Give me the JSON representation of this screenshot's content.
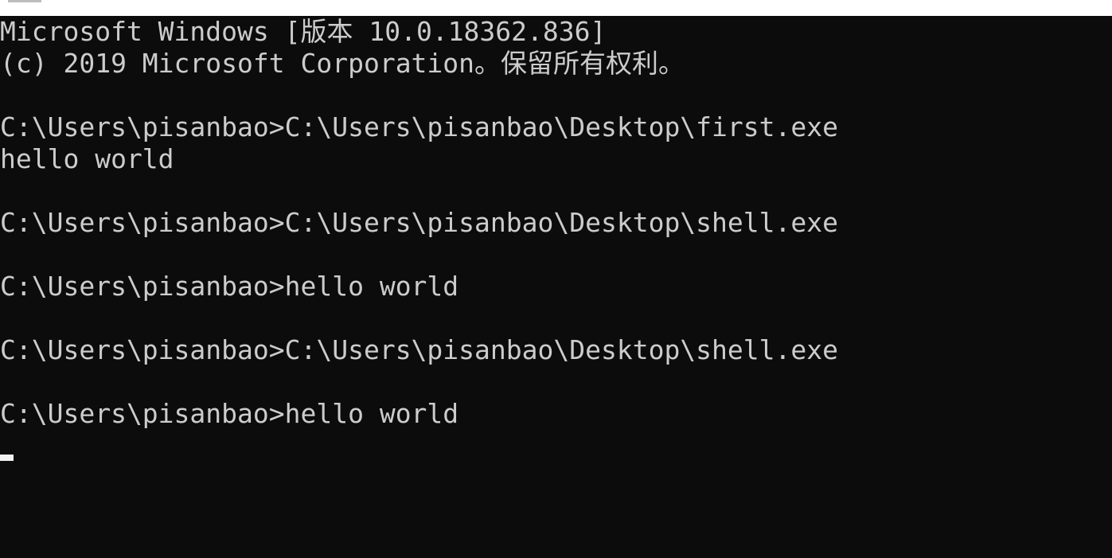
{
  "console": {
    "lines": [
      "Microsoft Windows [版本 10.0.18362.836]",
      "(c) 2019 Microsoft Corporation。保留所有权利。",
      "",
      "C:\\Users\\pisanbao>C:\\Users\\pisanbao\\Desktop\\first.exe",
      "hello world",
      "",
      "C:\\Users\\pisanbao>C:\\Users\\pisanbao\\Desktop\\shell.exe",
      "",
      "C:\\Users\\pisanbao>hello world",
      "",
      "C:\\Users\\pisanbao>C:\\Users\\pisanbao\\Desktop\\shell.exe",
      "",
      "C:\\Users\\pisanbao>hello world"
    ]
  },
  "colors": {
    "background": "#0c0c0c",
    "text": "#cccccc",
    "cursor": "#f2f2f2"
  }
}
